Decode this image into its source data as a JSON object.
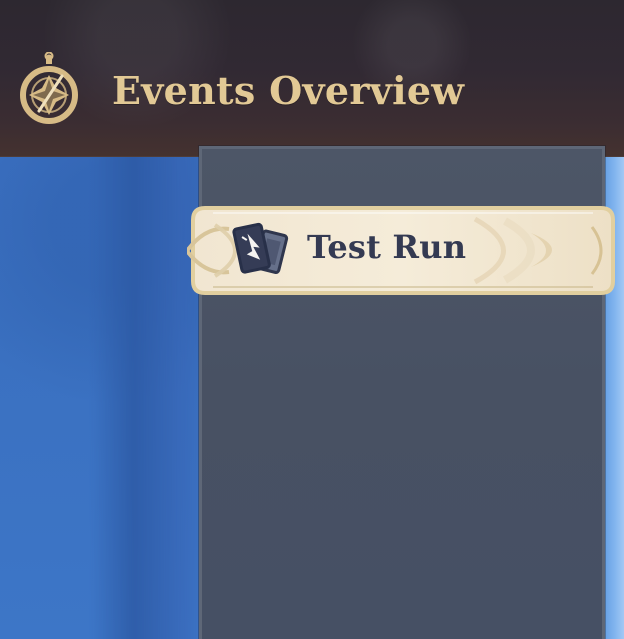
{
  "header": {
    "title": "Events Overview",
    "icon": "compass-icon"
  },
  "events": {
    "items": [
      {
        "label": "Test Run",
        "icon": "cards-icon",
        "selected": true
      }
    ]
  },
  "theme": {
    "header_background": "#312933",
    "title_color": "#e2c995",
    "panel_color": "#485163",
    "tab_background": "#eee2cb",
    "tab_text_color": "#343a52",
    "scene_blue": "#3d73c2"
  }
}
